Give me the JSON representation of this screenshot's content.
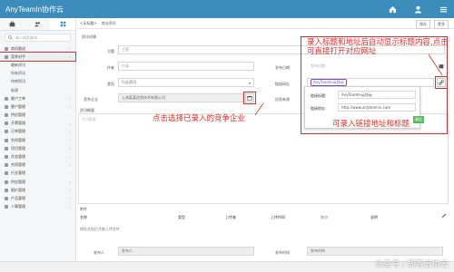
{
  "app": {
    "title": "AnyTeamIn协作云"
  },
  "sidebar": {
    "search_placeholder": "输入搜索查询",
    "items": [
      {
        "label": "商机跟进",
        "sub": false
      },
      {
        "label": "竞争对手",
        "sub": false
      },
      {
        "label": "最新资讯",
        "sub": true
      },
      {
        "label": "所有资讯",
        "sub": true
      },
      {
        "label": "待审资讯",
        "sub": true
      },
      {
        "label": "新建",
        "sub": true
      },
      {
        "label": "客户工单",
        "sub": false
      },
      {
        "label": "客户管理",
        "sub": false
      },
      {
        "label": "供应管理",
        "sub": false
      },
      {
        "label": "开票管理",
        "sub": false
      },
      {
        "label": "订单管理",
        "sub": false
      },
      {
        "label": "合同管理",
        "sub": false
      },
      {
        "label": "项目管理",
        "sub": false
      },
      {
        "label": "任务管理",
        "sub": false
      },
      {
        "label": "合同管理",
        "sub": false
      },
      {
        "label": "行业管理",
        "sub": false
      },
      {
        "label": "供应管理",
        "sub": false
      },
      {
        "label": "报价管理",
        "sub": false
      },
      {
        "label": "产品管理",
        "sub": false
      },
      {
        "label": "人事管理",
        "sub": false
      }
    ]
  },
  "tabs": [
    "<无标题>",
    "商业资讯"
  ],
  "toolbar": {
    "save": "保存",
    "more": "更多"
  },
  "form": {
    "section_basic": "资讯详情",
    "subject_label": "主题",
    "subject_placeholder": "主题",
    "author_label": "作者",
    "author_placeholder": "作者",
    "publish_date_label": "发布日期",
    "publish_date_placeholder": "发布日期",
    "category_label": "类别",
    "category_value": "行业资讯",
    "link_label": "链接网址",
    "link_value": "AnyTeamIn云协云",
    "competitor_label": "竞争企业",
    "competitor_value": "上海某某信息技术有限公司",
    "info_source_label": "信息来源",
    "info_source_value": "",
    "summary_section": "资讯概要",
    "summary_placeholder": "资讯概要"
  },
  "popup": {
    "title_label": "链接标题:",
    "title_value": "AnyTeamIn云协云",
    "url_label": "链接地址:",
    "url_value": "http://www.anyteamin.com",
    "ok_label": "确定"
  },
  "annotations": {
    "top_right": "录入标题和地址后自动显示标题内容,点击可直接打开对应网址",
    "popup": "可录入链接地址和标题",
    "competitor": "点击选择已录入的竞争企业"
  },
  "attachments": {
    "section": "附件",
    "columns": [
      "名称",
      "类型",
      "上传者",
      "上传时间",
      "大小",
      "说明"
    ],
    "empty_text": "保存文档后才能上传文件"
  },
  "footer_form": {
    "publisher_label": "发布人",
    "publisher_placeholder": "发布人",
    "publish_time_label": "发布时间",
    "publish_time_placeholder": "发布时间"
  },
  "watermark": "头条号 / 即客云协云"
}
